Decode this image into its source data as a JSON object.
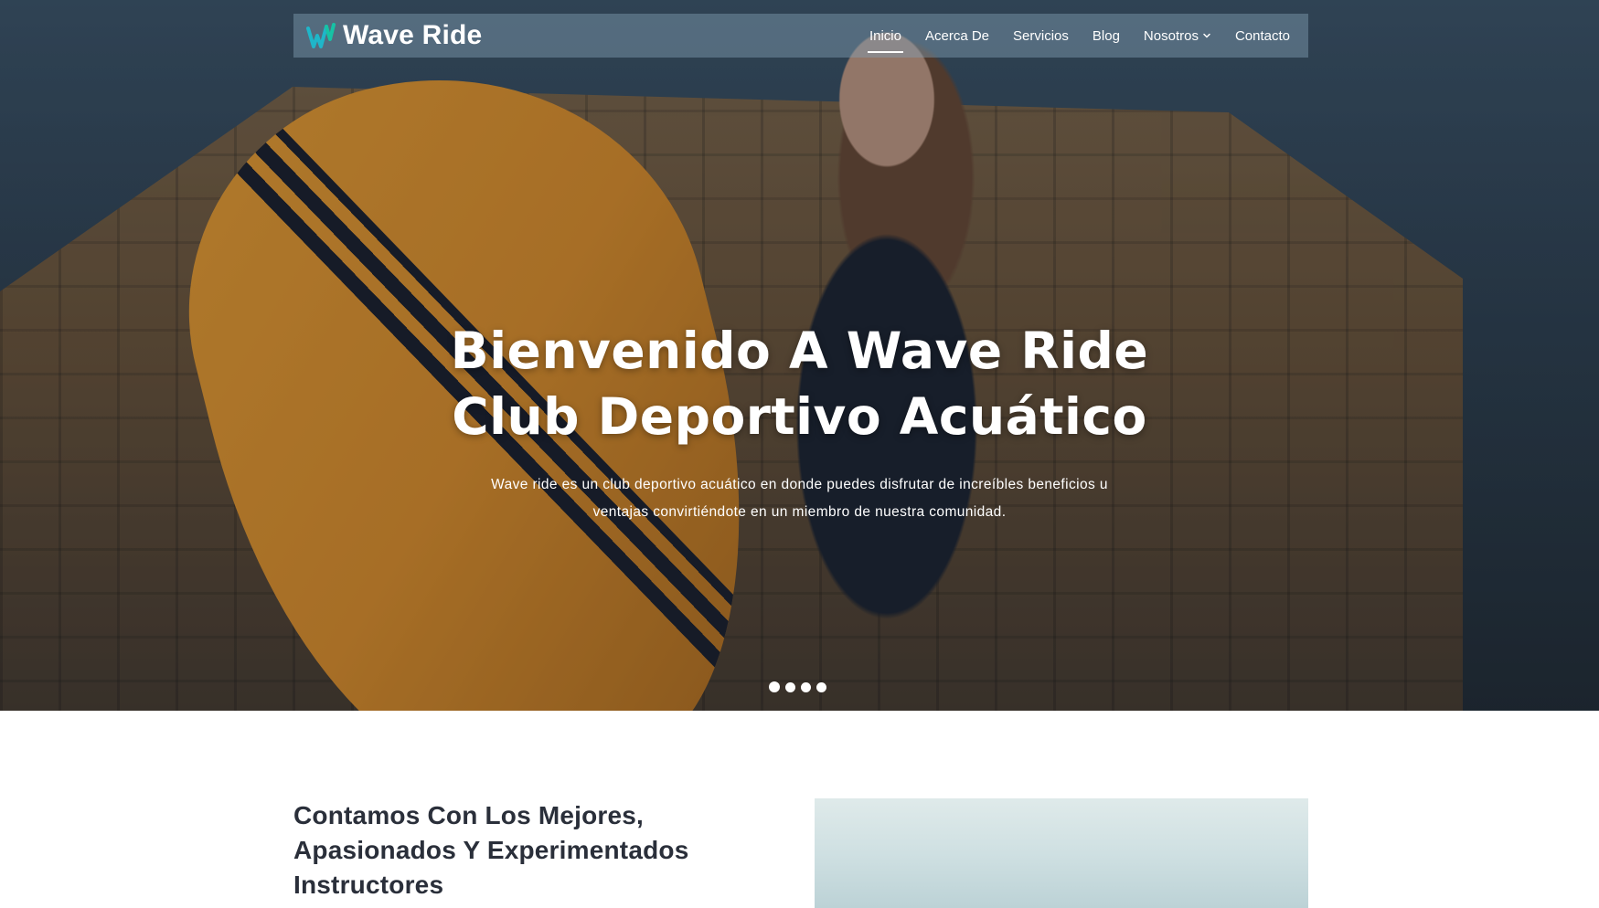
{
  "brand": {
    "name": "Wave Ride",
    "logo_icon": "wave-w-logo-icon",
    "logo_color": "#1fb6c9"
  },
  "nav": {
    "items": [
      {
        "label": "Inicio",
        "active": true
      },
      {
        "label": "Acerca De",
        "active": false
      },
      {
        "label": "Servicios",
        "active": false
      },
      {
        "label": "Blog",
        "active": false
      },
      {
        "label": "Nosotros",
        "active": false,
        "dropdown": true
      },
      {
        "label": "Contacto",
        "active": false
      }
    ]
  },
  "hero": {
    "title_line1": "Bienvenido A Wave Ride",
    "title_line2": "Club Deportivo Acuático",
    "description_line1": "Wave ride es un club deportivo acuático en donde puedes disfrutar de increíbles beneficios u",
    "description_line2": "ventajas convirtiéndote en un miembro de nuestra comunidad.",
    "slides_count": 4,
    "active_slide": 1
  },
  "about": {
    "heading": "Contamos Con Los Mejores, Apasionados Y Experimentados Instructores"
  },
  "colors": {
    "nav_bar_bg": "#6f8fa3",
    "text_light": "#ffffff",
    "heading_dark": "#2a2f3a"
  }
}
